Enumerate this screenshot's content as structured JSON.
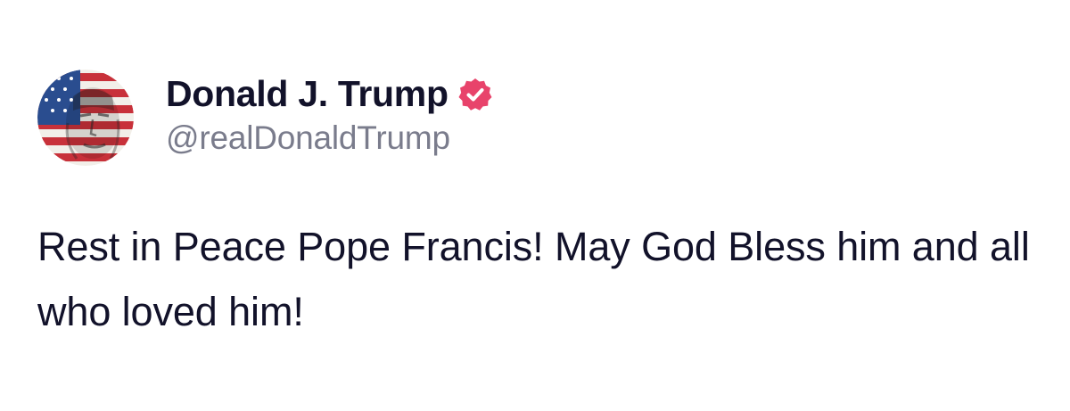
{
  "post": {
    "author": {
      "display_name": "Donald J. Trump",
      "handle": "@realDonaldTrump",
      "verified": true,
      "verified_badge_color": "#e8436b",
      "avatar_icon": "avatar-flag-portrait-icon"
    },
    "content": "Rest in Peace Pope Francis! May God Bless him and all who loved him!"
  },
  "colors": {
    "text_primary": "#12122a",
    "text_secondary": "#7a7c8c",
    "background": "#ffffff",
    "flag_red": "#c8313a",
    "flag_blue": "#2a4d8f"
  }
}
